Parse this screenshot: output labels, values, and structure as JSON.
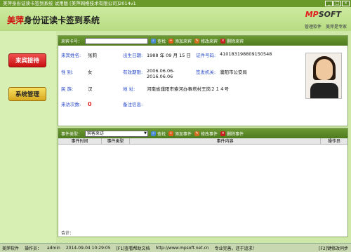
{
  "window": {
    "title": "美萍身份证读卡签到系统 试用版 [美萍网络技术有限公司]2014v1",
    "buttons": [
      "_",
      "□",
      "×"
    ]
  },
  "header": {
    "app_title_brand": "美萍",
    "app_title_rest": "身份证读卡签到系统",
    "logo_mp": "MP",
    "logo_soft": "SOFT",
    "links": [
      "管理软件",
      "美萍是专家"
    ]
  },
  "sidebar": {
    "reception": "来宾接待",
    "admin": "系统管理"
  },
  "toolbar1": {
    "card_label": "来宾卡号：",
    "search": "查找",
    "add": "添加来宾",
    "edit": "修改来宾",
    "delete": "删除来宾"
  },
  "visitor": {
    "name_label": "来宾姓名:",
    "name": "张莉",
    "birth_label": "出生日期:",
    "birth": "1988 年 09 月 15 日",
    "id_label": "证件号码:",
    "id": "410183198809150548",
    "gender_label": "性    别:",
    "gender": "女",
    "valid_label": "有效期限:",
    "valid": "2006.06.06-2016.06.06",
    "issuer_label": "签发机关:",
    "issuer": "濮阳市公安局",
    "ethnic_label": "民    族:",
    "ethnic": "汉",
    "address_label": "地    址:",
    "address": "河南省濮阳市索河办事塔村王岗２１４号",
    "visits_label": "来访次数:",
    "visits": "0",
    "remark_label": "备注信息:"
  },
  "toolbar2": {
    "type_label": "事件类型：",
    "type_value": "宾客来访",
    "search": "查找",
    "add": "添加事件",
    "edit": "修改事件",
    "delete": "删除事件"
  },
  "table": {
    "columns": [
      "事件时间",
      "事件类型",
      "事件内容",
      "操作员"
    ]
  },
  "footer": {
    "total": "合计："
  },
  "statusbar": {
    "software": "美萍软件",
    "operator_label": "操作员：",
    "operator": "admin",
    "datetime": "2014-09-04 10:29:05",
    "help": "[F1]查看帮助文档",
    "website": "http://www.mpsoft.net.cn",
    "service": "专业完善，还于追求！",
    "sync": "[F2]键修改同步"
  }
}
